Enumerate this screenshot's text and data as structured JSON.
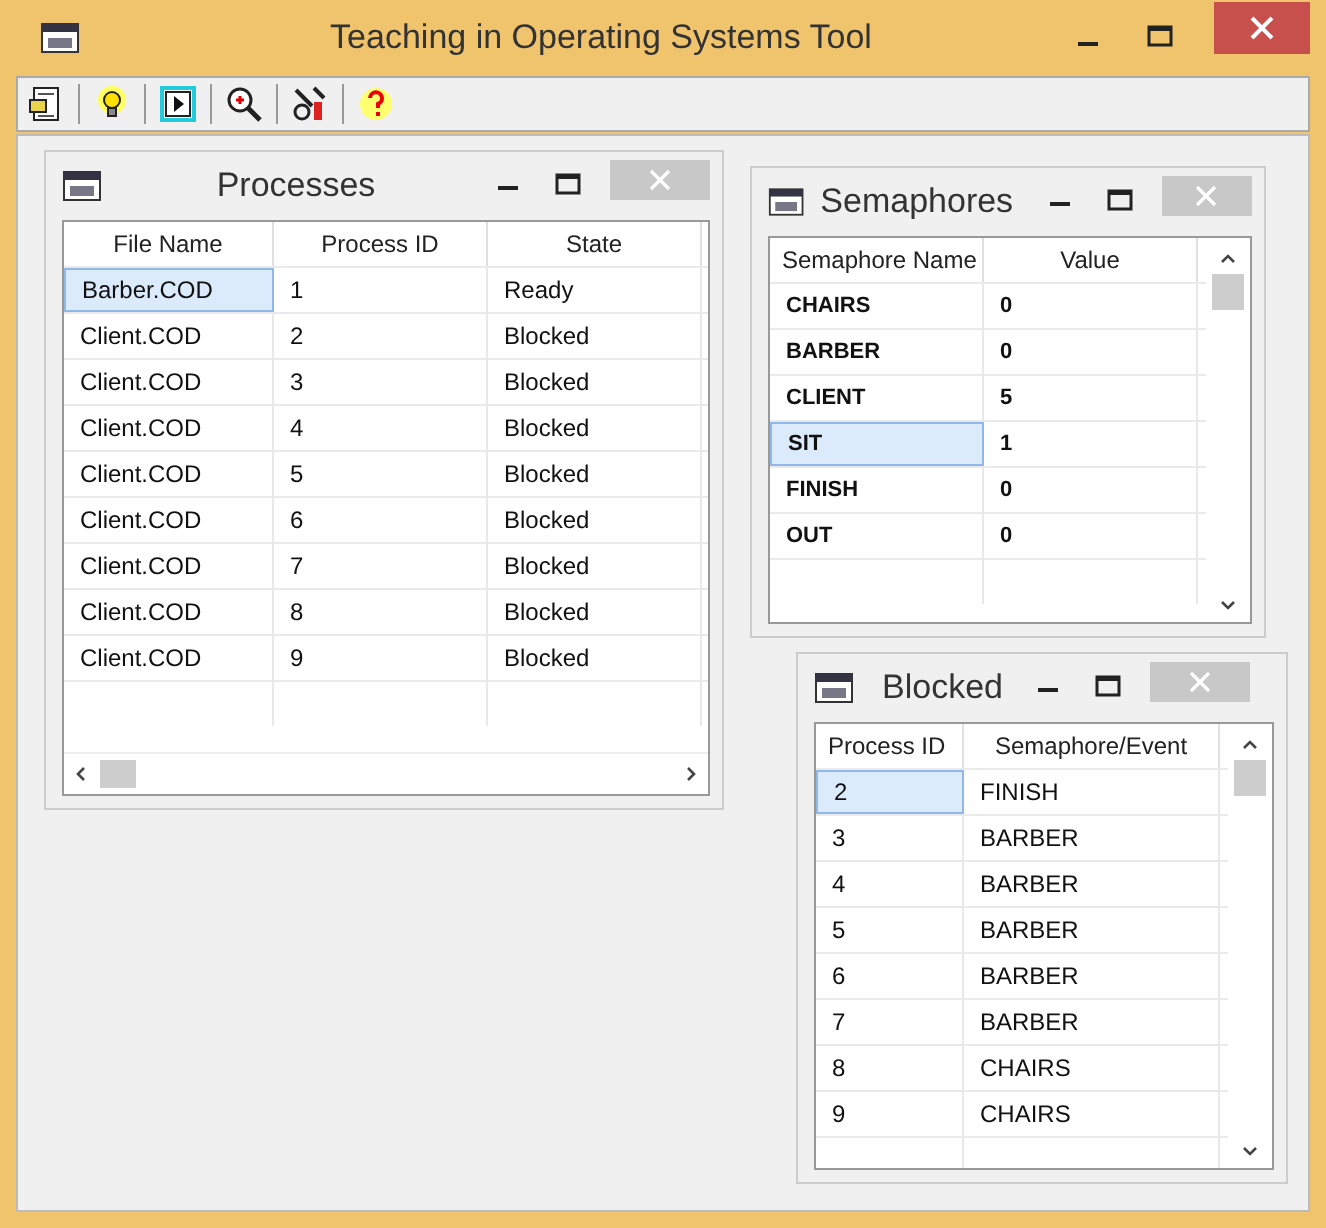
{
  "window": {
    "title": "Teaching in Operating Systems Tool"
  },
  "child_windows": [
    {
      "title": "Processes",
      "columns": [
        "File Name",
        "Process ID",
        "State"
      ],
      "rows": [
        {
          "cells": [
            "Barber.COD",
            "1",
            "Ready"
          ],
          "selected": true
        },
        {
          "cells": [
            "Client.COD",
            "2",
            "Blocked"
          ],
          "selected": false
        },
        {
          "cells": [
            "Client.COD",
            "3",
            "Blocked"
          ],
          "selected": false
        },
        {
          "cells": [
            "Client.COD",
            "4",
            "Blocked"
          ],
          "selected": false
        },
        {
          "cells": [
            "Client.COD",
            "5",
            "Blocked"
          ],
          "selected": false
        },
        {
          "cells": [
            "Client.COD",
            "6",
            "Blocked"
          ],
          "selected": false
        },
        {
          "cells": [
            "Client.COD",
            "7",
            "Blocked"
          ],
          "selected": false
        },
        {
          "cells": [
            "Client.COD",
            "8",
            "Blocked"
          ],
          "selected": false
        },
        {
          "cells": [
            "Client.COD",
            "9",
            "Blocked"
          ],
          "selected": false
        }
      ]
    },
    {
      "title": "Semaphores",
      "columns": [
        "Semaphore Name",
        "Value"
      ],
      "rows": [
        {
          "cells": [
            "CHAIRS",
            "0"
          ],
          "selected": false
        },
        {
          "cells": [
            "BARBER",
            "0"
          ],
          "selected": false
        },
        {
          "cells": [
            "CLIENT",
            "5"
          ],
          "selected": false
        },
        {
          "cells": [
            "SIT",
            "1"
          ],
          "selected": true
        },
        {
          "cells": [
            "FINISH",
            "0"
          ],
          "selected": false
        },
        {
          "cells": [
            "OUT",
            "0"
          ],
          "selected": false
        }
      ]
    },
    {
      "title": "Blocked",
      "columns": [
        "Process ID",
        "Semaphore/Event"
      ],
      "rows": [
        {
          "cells": [
            "2",
            "FINISH"
          ],
          "selected": true
        },
        {
          "cells": [
            "3",
            "BARBER"
          ],
          "selected": false
        },
        {
          "cells": [
            "4",
            "BARBER"
          ],
          "selected": false
        },
        {
          "cells": [
            "5",
            "BARBER"
          ],
          "selected": false
        },
        {
          "cells": [
            "6",
            "BARBER"
          ],
          "selected": false
        },
        {
          "cells": [
            "7",
            "BARBER"
          ],
          "selected": false
        },
        {
          "cells": [
            "8",
            "CHAIRS"
          ],
          "selected": false
        },
        {
          "cells": [
            "9",
            "CHAIRS"
          ],
          "selected": false
        }
      ]
    }
  ]
}
